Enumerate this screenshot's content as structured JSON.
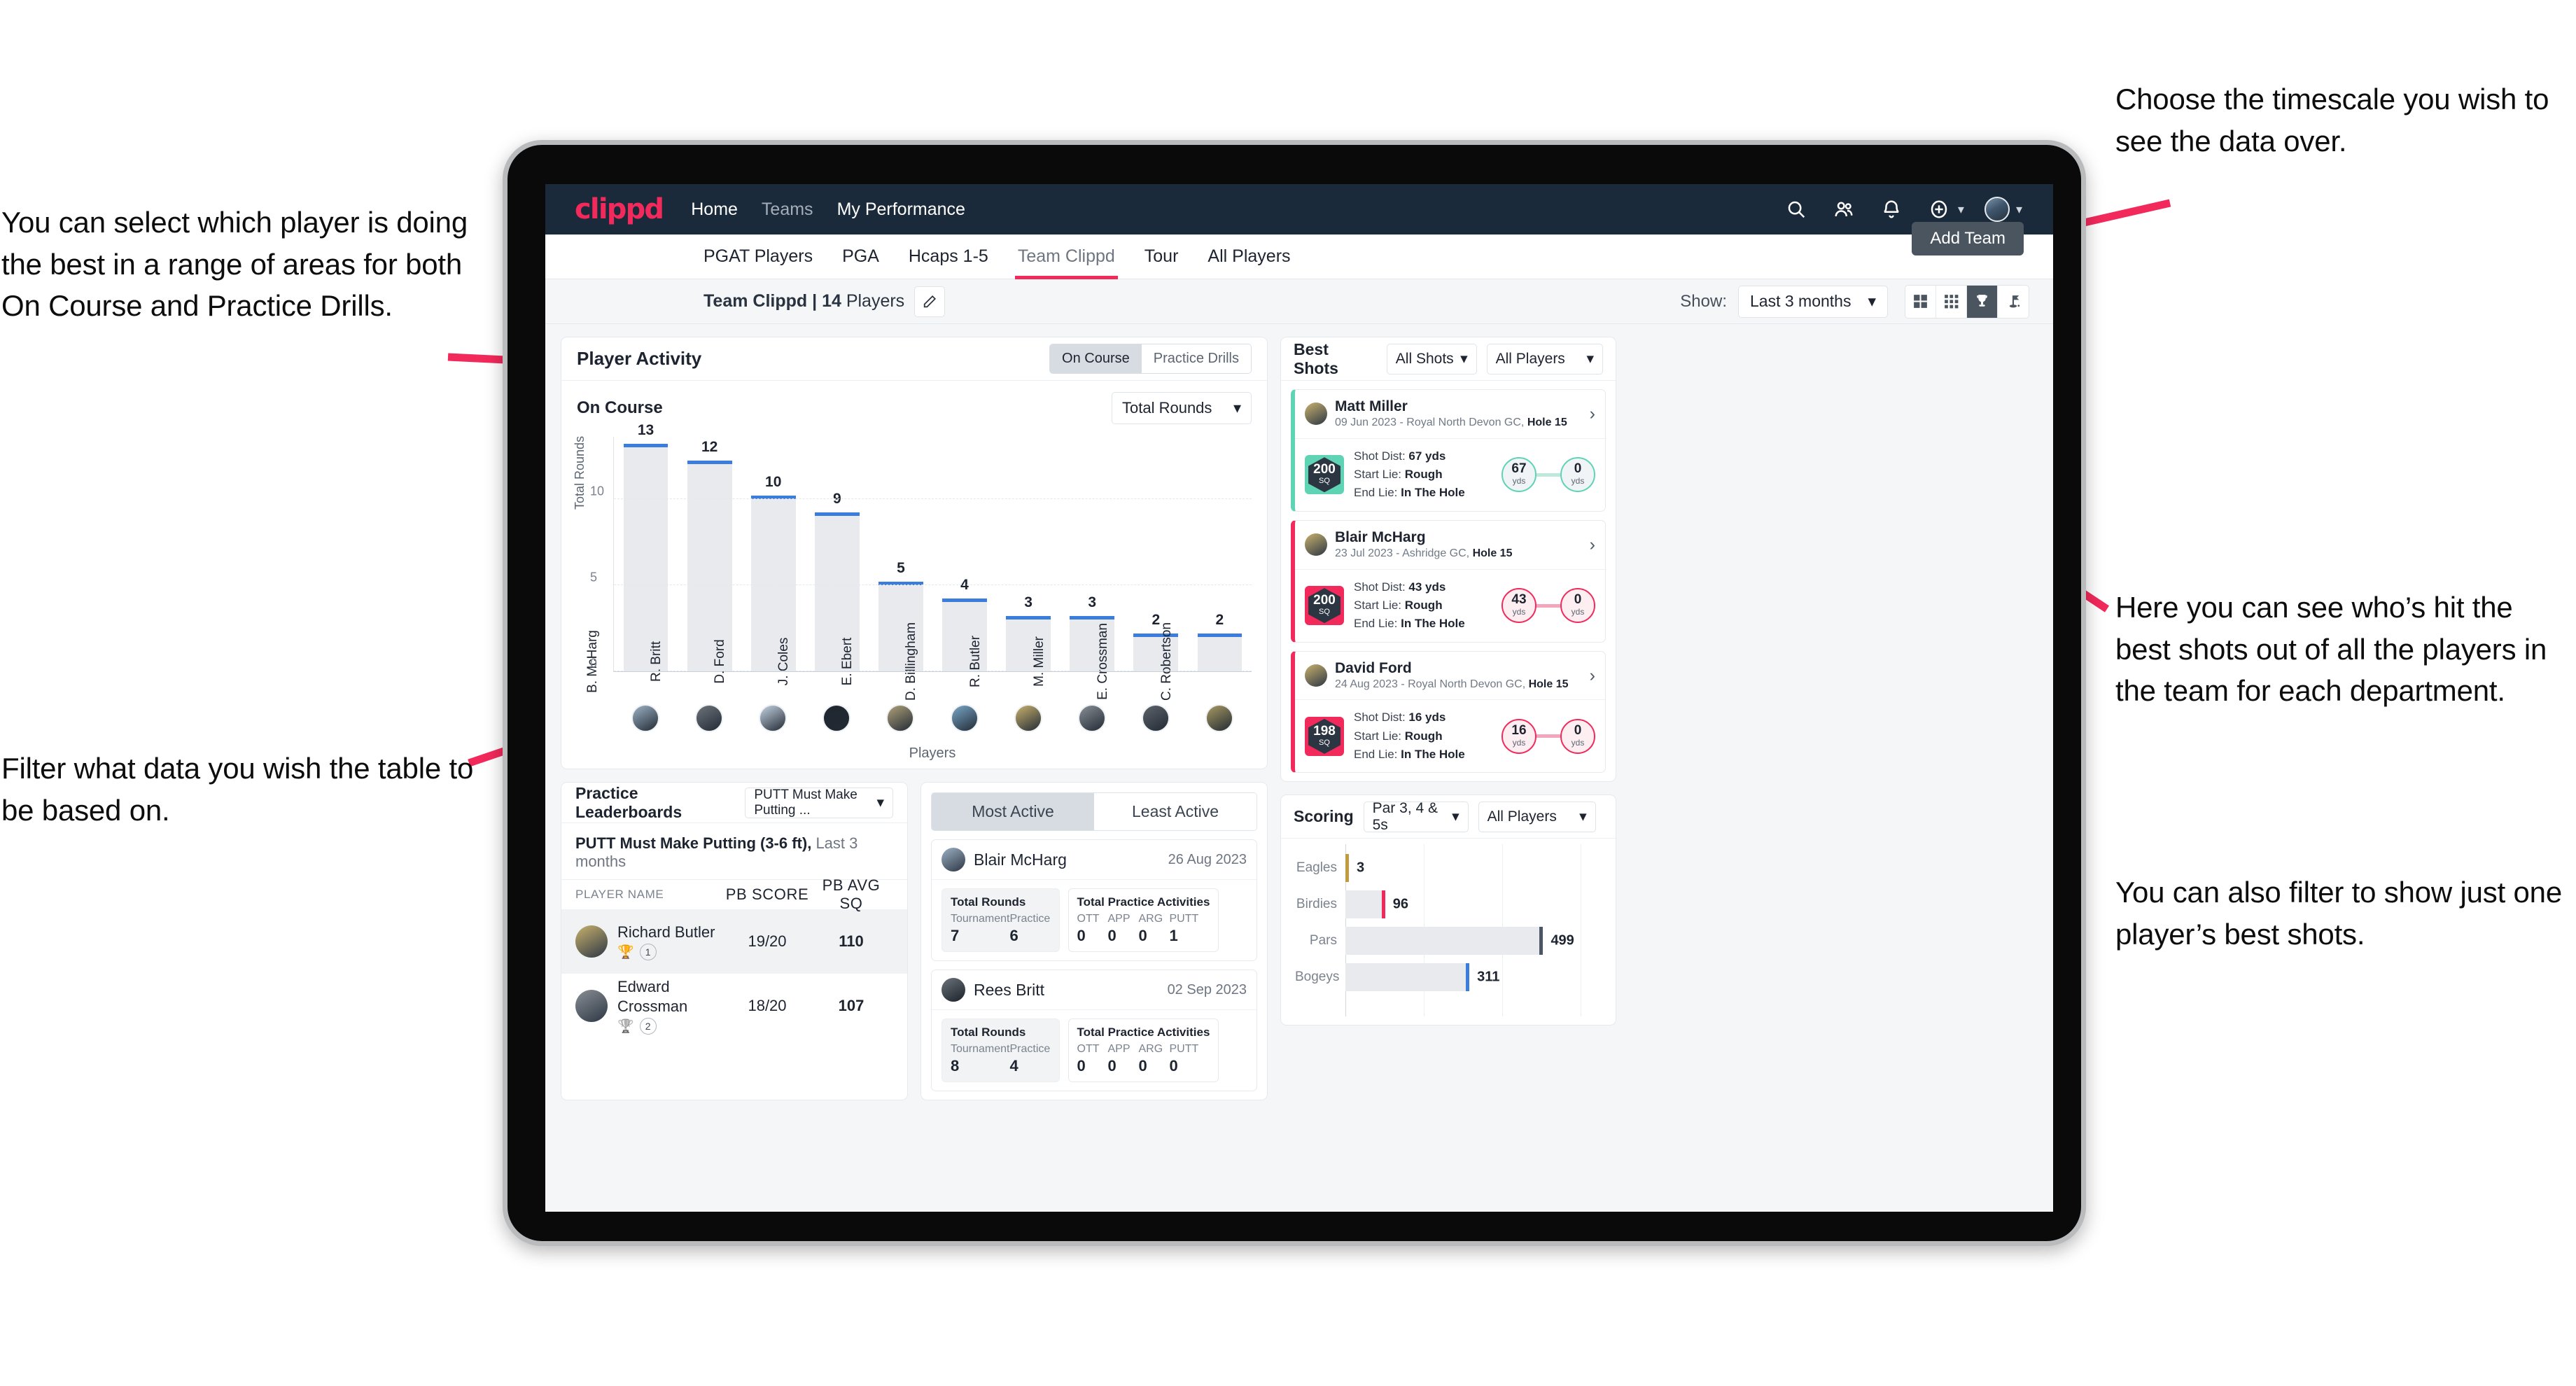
{
  "annotations": {
    "left_top": "You can select which player is doing the best in a range of areas for both On Course and Practice Drills.",
    "left_bottom": "Filter what data you wish the table to be based on.",
    "right_top": "Choose the timescale you wish to see the data over.",
    "right_mid": "Here you can see who’s hit the best shots out of all the players in the team for each department.",
    "right_bottom": "You can also filter to show just one player’s best shots."
  },
  "colors": {
    "brand": "#f2295b",
    "navbar": "#1b2a3a",
    "bar": "#3b7ddd",
    "teal": "#5ed4b4",
    "gold": "#c29b41"
  },
  "topnav": {
    "logo": "clippd",
    "links": [
      {
        "label": "Home",
        "dim": false
      },
      {
        "label": "Teams",
        "dim": true
      },
      {
        "label": "My Performance",
        "dim": false
      }
    ],
    "icons": [
      "search-icon",
      "people-icon",
      "bell-icon",
      "plus-circle-icon",
      "avatar"
    ]
  },
  "tabs": [
    {
      "label": "PGAT Players",
      "active": false
    },
    {
      "label": "PGA",
      "active": false
    },
    {
      "label": "Hcaps 1-5",
      "active": false
    },
    {
      "label": "Team Clippd",
      "active": true
    },
    {
      "label": "Tour",
      "active": false
    },
    {
      "label": "All Players",
      "active": false
    }
  ],
  "add_team_tooltip": "Add Team",
  "subheader": {
    "team_name": "Team Clippd",
    "separator": " | ",
    "player_count": "14",
    "players_word": " Players",
    "show_label": "Show:",
    "timescale": "Last 3 months",
    "view_buttons": [
      "grid-large-icon",
      "grid-small-icon",
      "trophy-icon",
      "flag-icon"
    ],
    "active_view": 2
  },
  "player_activity": {
    "title": "Player Activity",
    "segments": [
      {
        "label": "On Course",
        "active": true
      },
      {
        "label": "Practice Drills",
        "active": false
      }
    ],
    "sub_label": "On Course",
    "metric_select": "Total Rounds"
  },
  "chart_data": [
    {
      "type": "bar",
      "title": "On Course",
      "xlabel": "Players",
      "ylabel": "Total Rounds",
      "categories": [
        "B. McHarg",
        "R. Britt",
        "D. Ford",
        "J. Coles",
        "E. Ebert",
        "D. Billingham",
        "R. Butler",
        "M. Miller",
        "E. Crossman",
        "C. Robertson"
      ],
      "values": [
        13,
        12,
        10,
        9,
        5,
        4,
        3,
        3,
        2,
        2
      ],
      "ylim": [
        0,
        13
      ],
      "yticks": [
        0,
        5,
        10
      ],
      "grid": true,
      "legend": "none"
    },
    {
      "type": "bar",
      "orientation": "horizontal",
      "title": "Scoring",
      "categories": [
        "Eagles",
        "Birdies",
        "Pars",
        "Bogeys"
      ],
      "values": [
        3,
        96,
        499,
        311
      ],
      "cap_colors": [
        "#c29b41",
        "#f2295b",
        "#4b5563",
        "#3b7ddd"
      ],
      "xlim": [
        0,
        600
      ],
      "grid": true,
      "legend": "none"
    }
  ],
  "best_shots": {
    "title": "Best Shots",
    "filter_shots": "All Shots",
    "filter_players": "All Players",
    "cards": [
      {
        "player": "Matt Miller",
        "meta_date": "09 Jun 2023 - Royal North Devon GC, ",
        "meta_hole": "Hole 15",
        "score": "200",
        "score_unit": "SQ",
        "accent": "teal",
        "shot_dist_label": "Shot Dist: ",
        "shot_dist": "67 yds",
        "start_lie_label": "Start Lie: ",
        "start_lie": "Rough",
        "end_lie_label": "End Lie: ",
        "end_lie": "In The Hole",
        "from_val": "67",
        "from_unit": "yds",
        "to_val": "0",
        "to_unit": "yds"
      },
      {
        "player": "Blair McHarg",
        "meta_date": "23 Jul 2023 - Ashridge GC, ",
        "meta_hole": "Hole 15",
        "score": "200",
        "score_unit": "SQ",
        "accent": "pink",
        "shot_dist_label": "Shot Dist: ",
        "shot_dist": "43 yds",
        "start_lie_label": "Start Lie: ",
        "start_lie": "Rough",
        "end_lie_label": "End Lie: ",
        "end_lie": "In The Hole",
        "from_val": "43",
        "from_unit": "yds",
        "to_val": "0",
        "to_unit": "yds"
      },
      {
        "player": "David Ford",
        "meta_date": "24 Aug 2023 - Royal North Devon GC, ",
        "meta_hole": "Hole 15",
        "score": "198",
        "score_unit": "SQ",
        "accent": "pink",
        "shot_dist_label": "Shot Dist: ",
        "shot_dist": "16 yds",
        "start_lie_label": "Start Lie: ",
        "start_lie": "Rough",
        "end_lie_label": "End Lie: ",
        "end_lie": "In The Hole",
        "from_val": "16",
        "from_unit": "yds",
        "to_val": "0",
        "to_unit": "yds"
      }
    ]
  },
  "practice_leaderboards": {
    "title": "Practice Leaderboards",
    "drill_select": "PUTT Must Make Putting ...",
    "subtitle_bold": "PUTT Must Make Putting (3-6 ft),",
    "subtitle_rest": " Last 3 months",
    "columns": [
      "PLAYER NAME",
      "PB SCORE",
      "PB AVG SQ"
    ],
    "rows": [
      {
        "name": "Richard Butler",
        "rank": "1",
        "trophy": "gold",
        "pb_score": "19/20",
        "pb_avg_sq": "110"
      },
      {
        "name": "Edward Crossman",
        "rank": "2",
        "trophy": "silver",
        "pb_score": "18/20",
        "pb_avg_sq": "107"
      }
    ]
  },
  "activity": {
    "tabs": [
      {
        "label": "Most Active",
        "active": true
      },
      {
        "label": "Least Active",
        "active": false
      }
    ],
    "rounds_title": "Total Rounds",
    "practice_title": "Total Practice Activities",
    "rounds_keys": [
      "Tournament",
      "Practice"
    ],
    "practice_keys": [
      "OTT",
      "APP",
      "ARG",
      "PUTT"
    ],
    "cards": [
      {
        "player": "Blair McHarg",
        "date": "26 Aug 2023",
        "rounds": [
          "7",
          "6"
        ],
        "practice": [
          "0",
          "0",
          "0",
          "1"
        ]
      },
      {
        "player": "Rees Britt",
        "date": "02 Sep 2023",
        "rounds": [
          "8",
          "4"
        ],
        "practice": [
          "0",
          "0",
          "0",
          "0"
        ]
      }
    ]
  },
  "scoring": {
    "title": "Scoring",
    "filter_par": "Par 3, 4 & 5s",
    "filter_players": "All Players"
  }
}
